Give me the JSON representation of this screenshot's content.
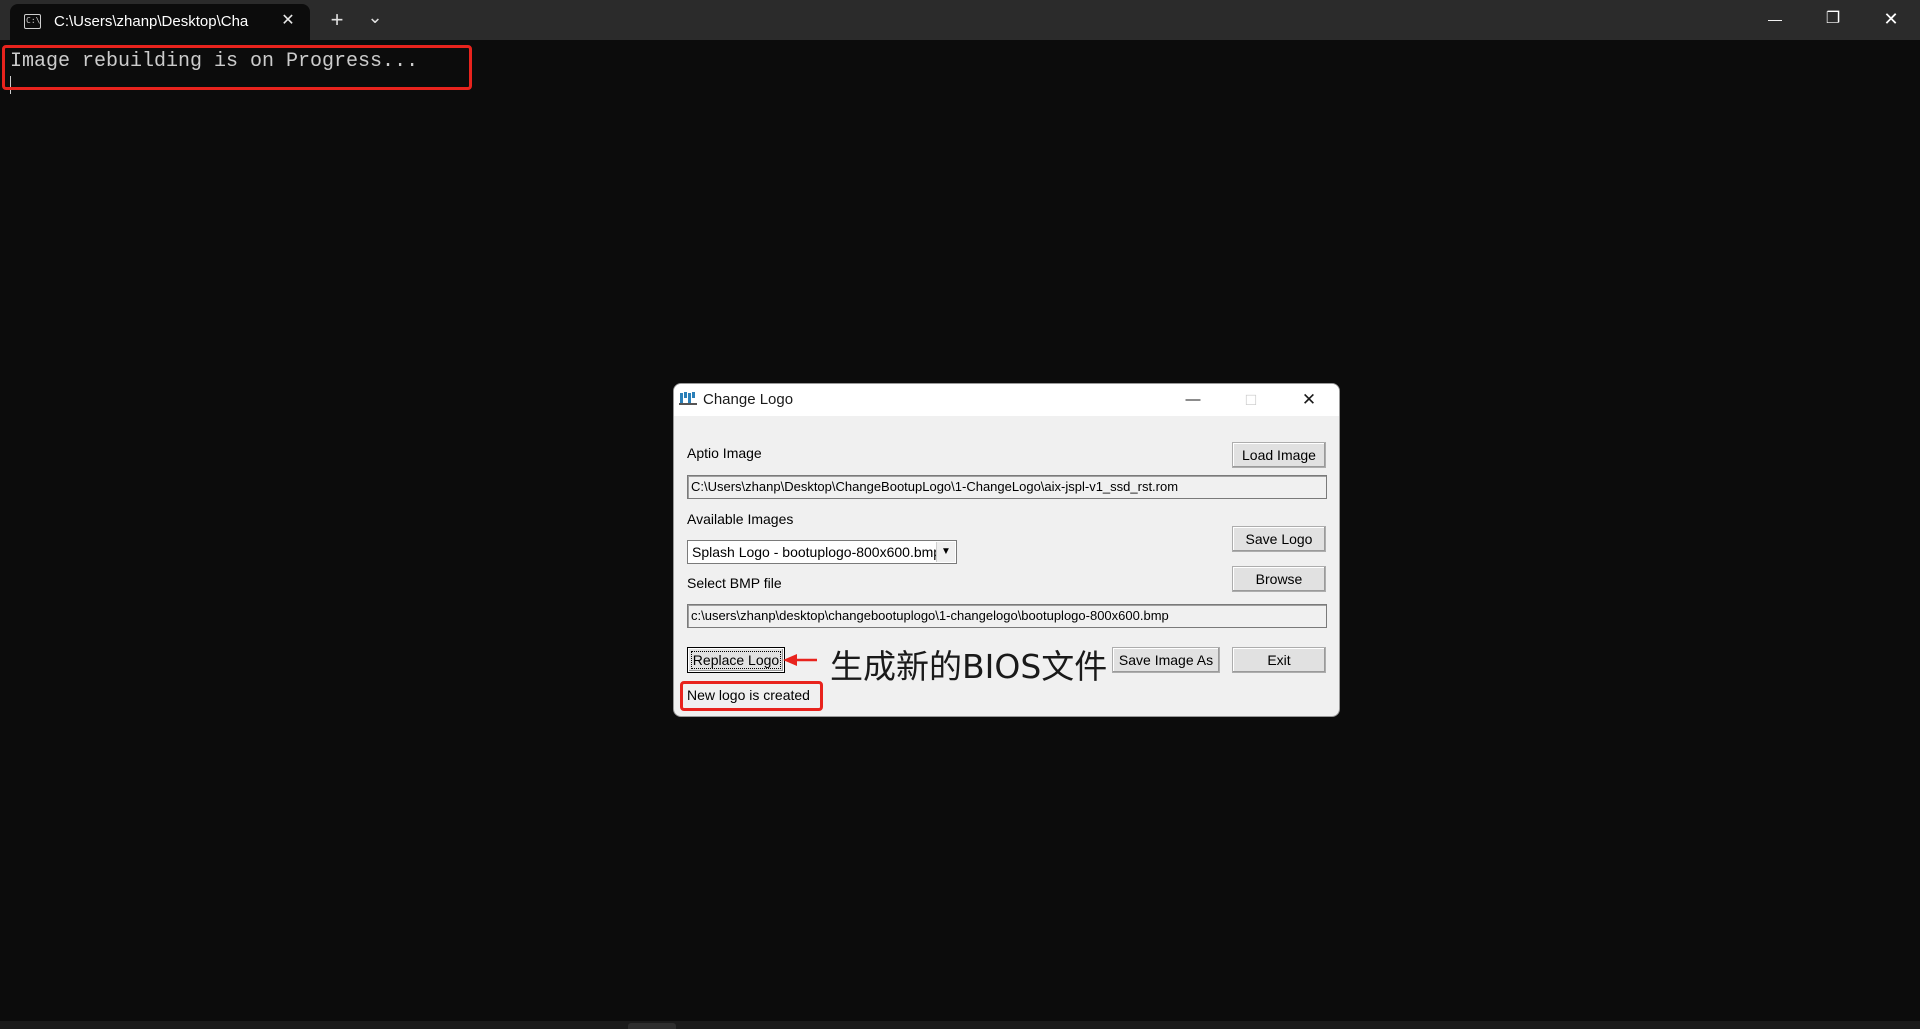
{
  "terminal": {
    "tab_title": "C:\\Users\\zhanp\\Desktop\\Cha",
    "tab_close_glyph": "✕",
    "new_tab_glyph": "+",
    "dropdown_glyph": "⌄",
    "minimize_glyph": "—",
    "maximize_glyph": "❐",
    "close_glyph": "✕",
    "output_line": "Image rebuilding is on Progress..."
  },
  "dialog": {
    "title": "Change Logo",
    "minimize_glyph": "—",
    "maximize_glyph": "□",
    "close_glyph": "✕",
    "aptio_label": "Aptio Image",
    "load_image_label": "Load Image",
    "aptio_path": "C:\\Users\\zhanp\\Desktop\\ChangeBootupLogo\\1-ChangeLogo\\aix-jspl-v1_ssd_rst.rom",
    "available_label": "Available Images",
    "available_selected": "Splash Logo - bootuplogo-800x600.bmp",
    "save_logo_label": "Save Logo",
    "browse_label": "Browse",
    "bmp_label": "Select BMP file",
    "bmp_path": "c:\\users\\zhanp\\desktop\\changebootuplogo\\1-changelogo\\bootuplogo-800x600.bmp",
    "replace_logo_label": "Replace Logo",
    "save_image_as_label": "Save Image As",
    "exit_label": "Exit",
    "status_text": "New logo is created"
  },
  "annotation": {
    "text": "生成新的BIOS文件",
    "highlight_color": "#e8231d"
  },
  "icons": {
    "tab": "terminal-icon",
    "dialog": "change-logo-app-icon",
    "arrow": "red-arrow-icon"
  }
}
